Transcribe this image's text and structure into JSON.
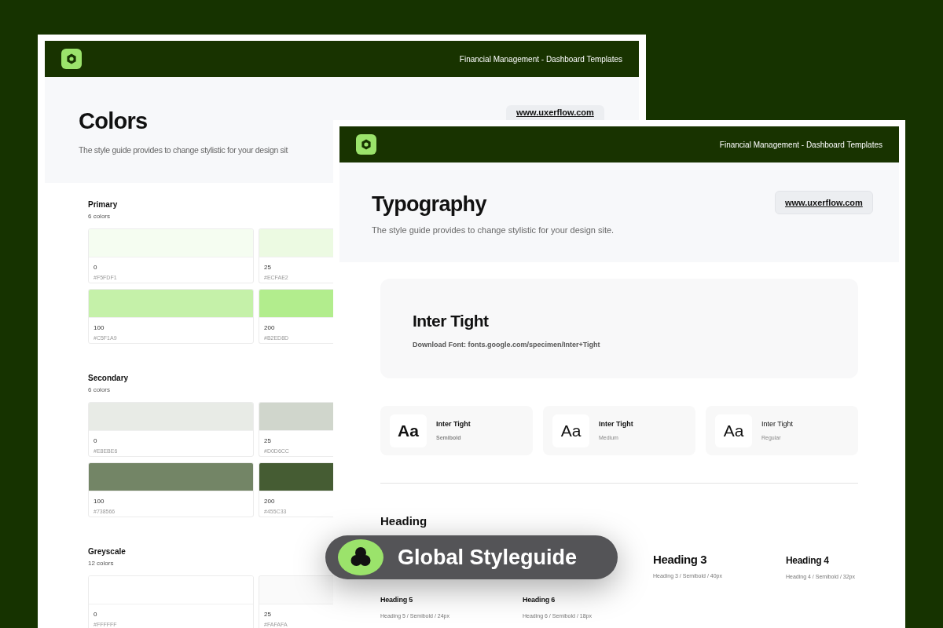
{
  "back_window": {
    "header_title": "Financial Management - Dashboard Templates",
    "title": "Colors",
    "subtitle": "The style guide provides to change stylistic for your design sit",
    "link_button": "www.uxerflow.com",
    "sections": [
      {
        "name": "Primary",
        "count": "6 colors",
        "swatches": [
          {
            "label": "0",
            "hex": "#F5FDF1",
            "color": "#f5fdf1"
          },
          {
            "label": "25",
            "hex": "#ECFAE2",
            "color": "#ecfae2"
          },
          {
            "label": "100",
            "hex": "#C5F1A9",
            "color": "#c5f1a9"
          },
          {
            "label": "200",
            "hex": "#B2ED8D",
            "color": "#b2ed8d"
          }
        ]
      },
      {
        "name": "Secondary",
        "count": "6 colors",
        "swatches": [
          {
            "label": "0",
            "hex": "#E8EBE6",
            "color": "#e8ebe6"
          },
          {
            "label": "25",
            "hex": "#D0D6CC",
            "color": "#d0d6cc"
          },
          {
            "label": "100",
            "hex": "#738566",
            "color": "#738566"
          },
          {
            "label": "200",
            "hex": "#455C33",
            "color": "#455c33"
          }
        ]
      },
      {
        "name": "Greyscale",
        "count": "12 colors",
        "swatches": [
          {
            "label": "0",
            "hex": "#FFFFFF",
            "color": "#ffffff"
          },
          {
            "label": "25",
            "hex": "#FAFAFA",
            "color": "#fafafa"
          }
        ]
      }
    ]
  },
  "front_window": {
    "header_title": "Financial Management - Dashboard Templates",
    "title": "Typography",
    "subtitle": "The style guide provides to change stylistic for your design site.",
    "link_button": "www.uxerflow.com",
    "font_card": {
      "name": "Inter Tight",
      "download": "Download Font: fonts.google.com/specimen/Inter+Tight"
    },
    "weights": [
      {
        "sample": "Aa",
        "name": "Inter Tight",
        "weight": "Semibold",
        "kind": "semibold"
      },
      {
        "sample": "Aa",
        "name": "Inter Tight",
        "weight": "Medium",
        "kind": "medium"
      },
      {
        "sample": "Aa",
        "name": "Inter Tight",
        "weight": "Regular",
        "kind": "regular"
      }
    ],
    "heading_section": "Heading",
    "headings": [
      {
        "kind": "h3",
        "name": "Heading 3",
        "caption": "Heading 3 / Semibold / 40px"
      },
      {
        "kind": "h4",
        "name": "Heading 4",
        "caption": "Heading 4 / Semibold / 32px"
      },
      {
        "kind": "h5",
        "name": "Heading 5",
        "caption": "Heading 5 / Semibold / 24px"
      },
      {
        "kind": "h6",
        "name": "Heading 6",
        "caption": "Heading 6 / Semibold / 18px"
      }
    ]
  },
  "badge": {
    "label": "Global Styleguide"
  }
}
